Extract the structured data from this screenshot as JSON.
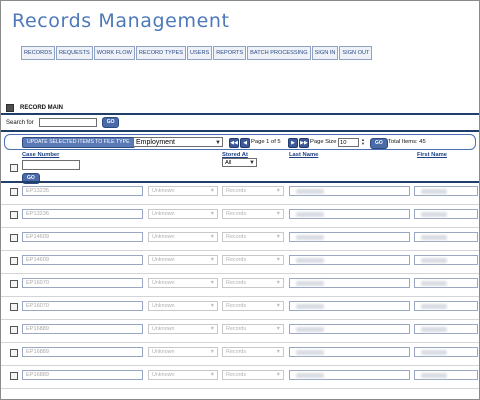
{
  "app": {
    "title": "Records Management"
  },
  "nav": [
    "RECORDS",
    "REQUESTS",
    "WORK FLOW",
    "RECORD TYPES",
    "USERS",
    "REPORTS",
    "BATCH PROCESSING",
    "SIGN IN",
    "SIGN OUT"
  ],
  "section": {
    "title": "RECORD MAIN"
  },
  "search": {
    "label": "Search for",
    "value": "",
    "go": "GO"
  },
  "toolbar": {
    "update_label": "UPDATE SELECTED ITEMS TO FILE TYPE",
    "file_type": "Employment",
    "page_text": "Page 1 of 5",
    "page_size_label": "Page Size",
    "page_size": "10",
    "go": "GO",
    "total": "Total Items: 45"
  },
  "columns": {
    "case_number": "Case Number",
    "stored_at": "Stored At",
    "last_name": "Last Name",
    "first_name": "First Name"
  },
  "filters": {
    "case_go": "GO",
    "stored_at": "All"
  },
  "rows": [
    {
      "case": "EP13235",
      "status": "Unknown",
      "stored": "Records"
    },
    {
      "case": "EP13236",
      "status": "Unknown",
      "stored": "Records"
    },
    {
      "case": "EP14609",
      "status": "Unknown",
      "stored": "Records"
    },
    {
      "case": "EP14609",
      "status": "Unknown",
      "stored": "Records"
    },
    {
      "case": "EP16070",
      "status": "Unknown",
      "stored": "Records"
    },
    {
      "case": "EP16070",
      "status": "Unknown",
      "stored": "Records"
    },
    {
      "case": "EP16889",
      "status": "Unknown",
      "stored": "Records"
    },
    {
      "case": "EP16889",
      "status": "Unknown",
      "stored": "Records"
    },
    {
      "case": "EP16889",
      "status": "Unknown",
      "stored": "Records"
    }
  ]
}
